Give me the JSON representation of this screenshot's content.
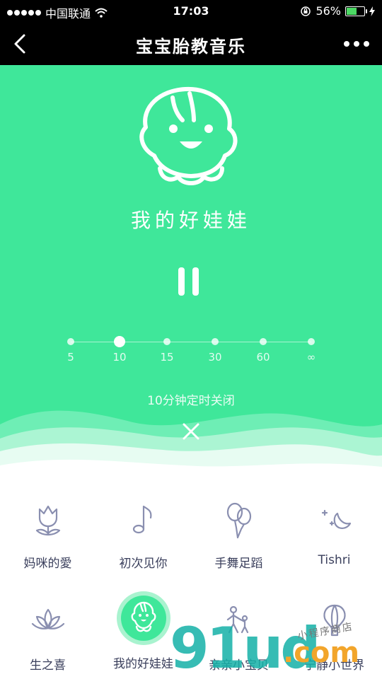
{
  "status_bar": {
    "carrier": "中国联通",
    "time": "17:03",
    "battery": "56%"
  },
  "nav": {
    "title": "宝宝胎教音乐"
  },
  "player": {
    "song_title": "我的好娃娃",
    "timer_options": [
      "5",
      "10",
      "15",
      "30",
      "60",
      "∞"
    ],
    "timer_selected": "10",
    "timer_status": "10分钟定时关闭"
  },
  "categories": [
    {
      "label": "妈咪的愛",
      "icon": "tulip-icon"
    },
    {
      "label": "初次见你",
      "icon": "music-note-icon"
    },
    {
      "label": "手舞足蹈",
      "icon": "balloons-icon"
    },
    {
      "label": "Tishri",
      "icon": "moon-stars-icon"
    },
    {
      "label": "生之喜",
      "icon": "lotus-icon"
    },
    {
      "label": "我的好娃娃",
      "icon": "baby-face-icon",
      "active": true
    },
    {
      "label": "亲亲小宝贝",
      "icon": "parent-child-icon"
    },
    {
      "label": "宁静小世界",
      "icon": "hot-air-balloon-icon"
    }
  ],
  "watermark": {
    "brand": "91ud",
    "suffix": ".com",
    "tagline": "小程序商店"
  },
  "colors": {
    "accent": "#3fe79a",
    "text": "#3a3f5c",
    "icon": "#8a8fb0"
  }
}
